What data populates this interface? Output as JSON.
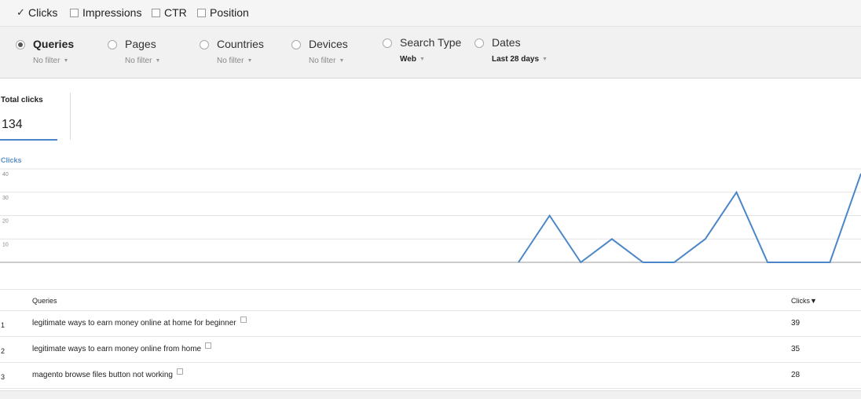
{
  "metrics": [
    {
      "label": "Clicks",
      "checked": true
    },
    {
      "label": "Impressions",
      "checked": false
    },
    {
      "label": "CTR",
      "checked": false
    },
    {
      "label": "Position",
      "checked": false
    }
  ],
  "dimensions": [
    {
      "label": "Queries",
      "filter": "No filter",
      "selected": true
    },
    {
      "label": "Pages",
      "filter": "No filter",
      "selected": false
    },
    {
      "label": "Countries",
      "filter": "No filter",
      "selected": false
    },
    {
      "label": "Devices",
      "filter": "No filter",
      "selected": false
    },
    {
      "label": "Search Type",
      "filter": "Web",
      "selected": false
    },
    {
      "label": "Dates",
      "filter": "Last 28 days",
      "selected": false
    }
  ],
  "summary": {
    "total_clicks_label": "Total clicks",
    "total_clicks_value": "134"
  },
  "chart_data": {
    "type": "line",
    "title": "Clicks",
    "xlabel": "",
    "ylabel": "",
    "ylim": [
      0,
      40
    ],
    "yticks": [
      10,
      20,
      30,
      40
    ],
    "grid": true,
    "color": "#4a86c8",
    "values": [
      0,
      20,
      0,
      10,
      0,
      0,
      10,
      30,
      0,
      0,
      0,
      38
    ]
  },
  "table": {
    "headers": {
      "query": "Queries",
      "clicks": "Clicks▼"
    },
    "rows": [
      {
        "index": "1",
        "query": "legitimate ways to earn money online at home for beginner",
        "clicks": "39"
      },
      {
        "index": "2",
        "query": "legitimate ways to earn money online from home",
        "clicks": "35"
      },
      {
        "index": "3",
        "query": "magento browse files button not working",
        "clicks": "28"
      }
    ]
  }
}
